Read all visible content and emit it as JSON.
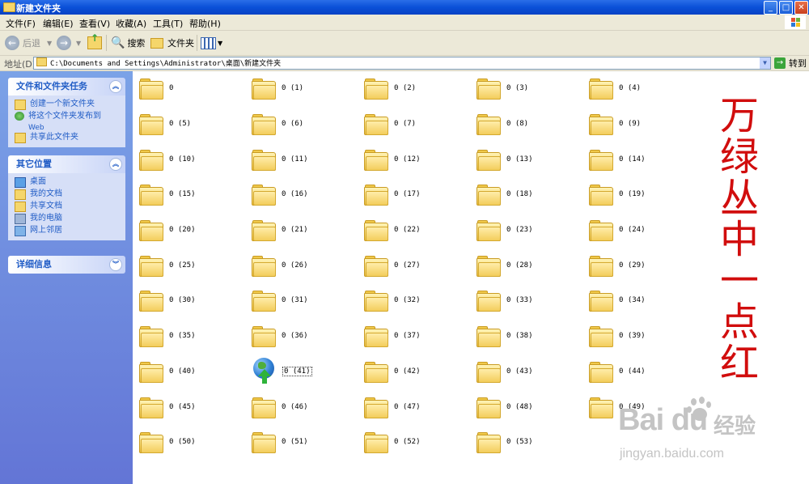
{
  "window": {
    "title": "新建文件夹",
    "controls": [
      "_",
      "□",
      "✕"
    ]
  },
  "menu": [
    "文件(F)",
    "编辑(E)",
    "查看(V)",
    "收藏(A)",
    "工具(T)",
    "帮助(H)"
  ],
  "toolbar": {
    "back_label": "后退",
    "search_label": "搜索",
    "folders_label": "文件夹"
  },
  "address": {
    "label": "地址(D)",
    "path": "C:\\Documents and Settings\\Administrator\\桌面\\新建文件夹",
    "go_label": "转到"
  },
  "tasks": {
    "title": "文件和文件夹任务",
    "items": [
      {
        "label": "创建一个新文件夹",
        "icon": "new-folder-icon"
      },
      {
        "label": "将这个文件夹发布到",
        "sub": "Web",
        "icon": "publish-web-icon"
      },
      {
        "label": "共享此文件夹",
        "icon": "share-folder-icon"
      }
    ]
  },
  "places": {
    "title": "其它位置",
    "items": [
      {
        "label": "桌面",
        "icon": "desktop-icon"
      },
      {
        "label": "我的文档",
        "icon": "my-documents-icon"
      },
      {
        "label": "共享文档",
        "icon": "shared-documents-icon"
      },
      {
        "label": "我的电脑",
        "icon": "my-computer-icon"
      },
      {
        "label": "网上邻居",
        "icon": "network-places-icon"
      }
    ]
  },
  "details": {
    "title": "详细信息"
  },
  "files": [
    "0",
    "0 (1)",
    "0 (2)",
    "0 (3)",
    "0 (4)",
    "0 (5)",
    "0 (6)",
    "0 (7)",
    "0 (8)",
    "0 (9)",
    "0 (10)",
    "0 (11)",
    "0 (12)",
    "0 (13)",
    "0 (14)",
    "0 (15)",
    "0 (16)",
    "0 (17)",
    "0 (18)",
    "0 (19)",
    "0 (20)",
    "0 (21)",
    "0 (22)",
    "0 (23)",
    "0 (24)",
    "0 (25)",
    "0 (26)",
    "0 (27)",
    "0 (28)",
    "0 (29)",
    "0 (30)",
    "0 (31)",
    "0 (32)",
    "0 (33)",
    "0 (34)",
    "0 (35)",
    "0 (36)",
    "0 (37)",
    "0 (38)",
    "0 (39)",
    "0 (40)",
    "0 (41)",
    "0 (42)",
    "0 (43)",
    "0 (44)",
    "0 (45)",
    "0 (46)",
    "0 (47)",
    "0 (48)",
    "0 (49)",
    "0 (50)",
    "0 (51)",
    "0 (52)",
    "0 (53)"
  ],
  "special_item": {
    "index": 41,
    "icon": "globe-download-icon",
    "selected": true
  },
  "calligraphy": "万绿丛中一点红",
  "watermark": {
    "brand": "Bai du",
    "suffix": "经验",
    "url": "jingyan.baidu.com"
  },
  "colors": {
    "titlebar": "#0a50d8",
    "sidebar": "#6375d6",
    "calligraphy": "#d10d0d",
    "folder": "#f5d66b"
  }
}
